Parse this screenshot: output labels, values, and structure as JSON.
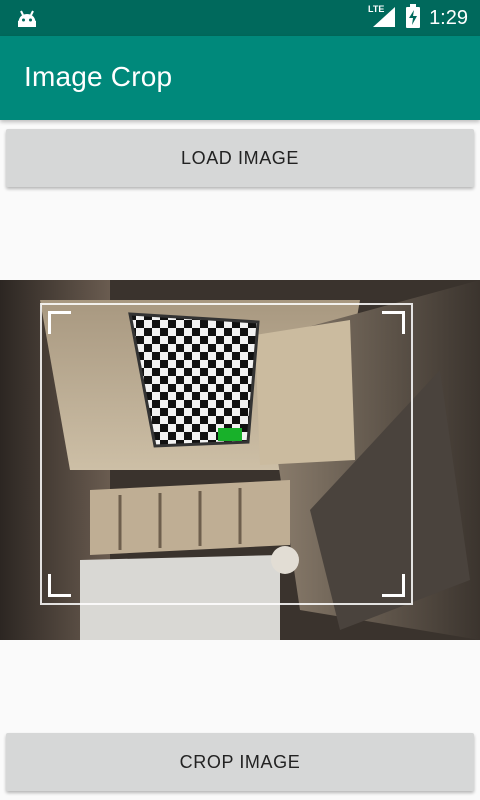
{
  "status_bar": {
    "time": "1:29",
    "network": "LTE",
    "icons": [
      "android-icon",
      "signal-icon",
      "battery-charging-icon"
    ]
  },
  "app_bar": {
    "title": "Image Crop"
  },
  "buttons": {
    "load_label": "LOAD IMAGE",
    "crop_label": "CROP IMAGE"
  },
  "colors": {
    "status_bar": "#00695c",
    "app_bar": "#00897b",
    "button": "#d6d7d7"
  }
}
